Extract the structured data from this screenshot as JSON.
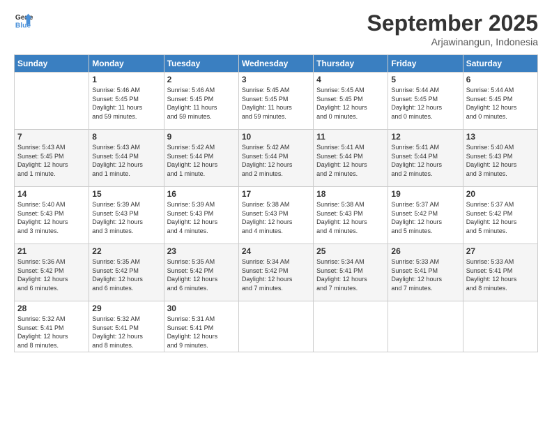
{
  "logo": {
    "line1": "General",
    "line2": "Blue"
  },
  "title": "September 2025",
  "subtitle": "Arjawinangun, Indonesia",
  "days_header": [
    "Sunday",
    "Monday",
    "Tuesday",
    "Wednesday",
    "Thursday",
    "Friday",
    "Saturday"
  ],
  "weeks": [
    [
      {
        "day": "",
        "info": ""
      },
      {
        "day": "1",
        "info": "Sunrise: 5:46 AM\nSunset: 5:45 PM\nDaylight: 11 hours\nand 59 minutes."
      },
      {
        "day": "2",
        "info": "Sunrise: 5:46 AM\nSunset: 5:45 PM\nDaylight: 11 hours\nand 59 minutes."
      },
      {
        "day": "3",
        "info": "Sunrise: 5:45 AM\nSunset: 5:45 PM\nDaylight: 11 hours\nand 59 minutes."
      },
      {
        "day": "4",
        "info": "Sunrise: 5:45 AM\nSunset: 5:45 PM\nDaylight: 12 hours\nand 0 minutes."
      },
      {
        "day": "5",
        "info": "Sunrise: 5:44 AM\nSunset: 5:45 PM\nDaylight: 12 hours\nand 0 minutes."
      },
      {
        "day": "6",
        "info": "Sunrise: 5:44 AM\nSunset: 5:45 PM\nDaylight: 12 hours\nand 0 minutes."
      }
    ],
    [
      {
        "day": "7",
        "info": "Sunrise: 5:43 AM\nSunset: 5:45 PM\nDaylight: 12 hours\nand 1 minute."
      },
      {
        "day": "8",
        "info": "Sunrise: 5:43 AM\nSunset: 5:44 PM\nDaylight: 12 hours\nand 1 minute."
      },
      {
        "day": "9",
        "info": "Sunrise: 5:42 AM\nSunset: 5:44 PM\nDaylight: 12 hours\nand 1 minute."
      },
      {
        "day": "10",
        "info": "Sunrise: 5:42 AM\nSunset: 5:44 PM\nDaylight: 12 hours\nand 2 minutes."
      },
      {
        "day": "11",
        "info": "Sunrise: 5:41 AM\nSunset: 5:44 PM\nDaylight: 12 hours\nand 2 minutes."
      },
      {
        "day": "12",
        "info": "Sunrise: 5:41 AM\nSunset: 5:44 PM\nDaylight: 12 hours\nand 2 minutes."
      },
      {
        "day": "13",
        "info": "Sunrise: 5:40 AM\nSunset: 5:43 PM\nDaylight: 12 hours\nand 3 minutes."
      }
    ],
    [
      {
        "day": "14",
        "info": "Sunrise: 5:40 AM\nSunset: 5:43 PM\nDaylight: 12 hours\nand 3 minutes."
      },
      {
        "day": "15",
        "info": "Sunrise: 5:39 AM\nSunset: 5:43 PM\nDaylight: 12 hours\nand 3 minutes."
      },
      {
        "day": "16",
        "info": "Sunrise: 5:39 AM\nSunset: 5:43 PM\nDaylight: 12 hours\nand 4 minutes."
      },
      {
        "day": "17",
        "info": "Sunrise: 5:38 AM\nSunset: 5:43 PM\nDaylight: 12 hours\nand 4 minutes."
      },
      {
        "day": "18",
        "info": "Sunrise: 5:38 AM\nSunset: 5:43 PM\nDaylight: 12 hours\nand 4 minutes."
      },
      {
        "day": "19",
        "info": "Sunrise: 5:37 AM\nSunset: 5:42 PM\nDaylight: 12 hours\nand 5 minutes."
      },
      {
        "day": "20",
        "info": "Sunrise: 5:37 AM\nSunset: 5:42 PM\nDaylight: 12 hours\nand 5 minutes."
      }
    ],
    [
      {
        "day": "21",
        "info": "Sunrise: 5:36 AM\nSunset: 5:42 PM\nDaylight: 12 hours\nand 6 minutes."
      },
      {
        "day": "22",
        "info": "Sunrise: 5:35 AM\nSunset: 5:42 PM\nDaylight: 12 hours\nand 6 minutes."
      },
      {
        "day": "23",
        "info": "Sunrise: 5:35 AM\nSunset: 5:42 PM\nDaylight: 12 hours\nand 6 minutes."
      },
      {
        "day": "24",
        "info": "Sunrise: 5:34 AM\nSunset: 5:42 PM\nDaylight: 12 hours\nand 7 minutes."
      },
      {
        "day": "25",
        "info": "Sunrise: 5:34 AM\nSunset: 5:41 PM\nDaylight: 12 hours\nand 7 minutes."
      },
      {
        "day": "26",
        "info": "Sunrise: 5:33 AM\nSunset: 5:41 PM\nDaylight: 12 hours\nand 7 minutes."
      },
      {
        "day": "27",
        "info": "Sunrise: 5:33 AM\nSunset: 5:41 PM\nDaylight: 12 hours\nand 8 minutes."
      }
    ],
    [
      {
        "day": "28",
        "info": "Sunrise: 5:32 AM\nSunset: 5:41 PM\nDaylight: 12 hours\nand 8 minutes."
      },
      {
        "day": "29",
        "info": "Sunrise: 5:32 AM\nSunset: 5:41 PM\nDaylight: 12 hours\nand 8 minutes."
      },
      {
        "day": "30",
        "info": "Sunrise: 5:31 AM\nSunset: 5:41 PM\nDaylight: 12 hours\nand 9 minutes."
      },
      {
        "day": "",
        "info": ""
      },
      {
        "day": "",
        "info": ""
      },
      {
        "day": "",
        "info": ""
      },
      {
        "day": "",
        "info": ""
      }
    ]
  ]
}
